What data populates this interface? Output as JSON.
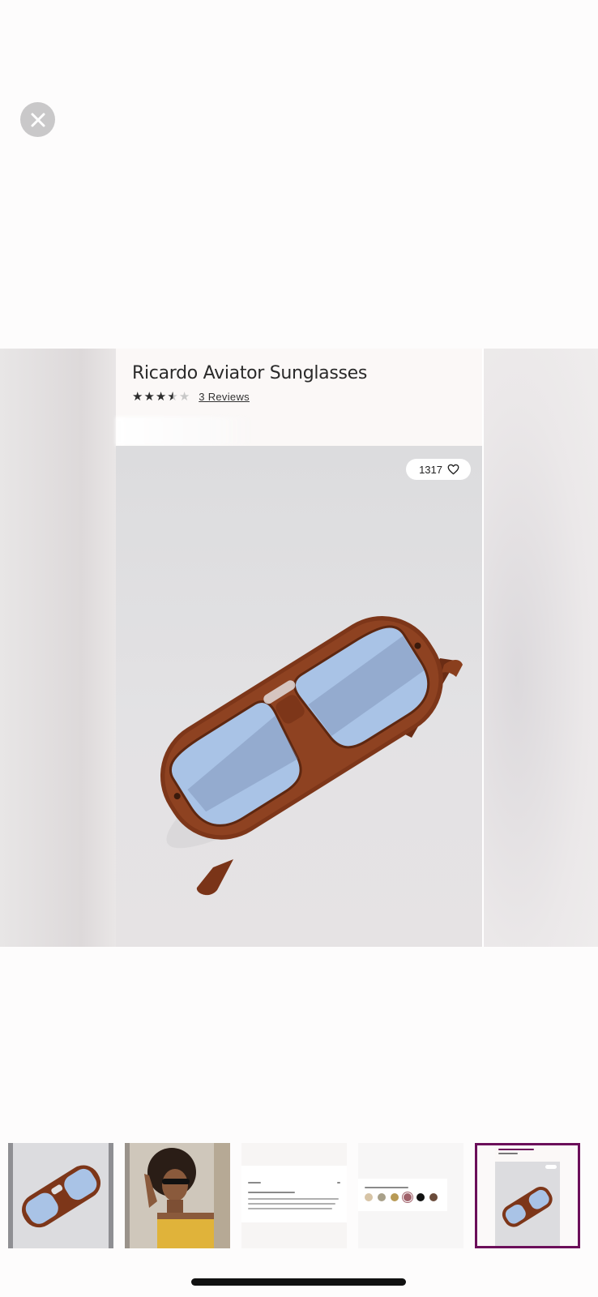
{
  "product": {
    "title": "Ricardo Aviator Sunglasses",
    "rating_stars": 3.5,
    "rating_max": 5,
    "reviews_label": "3 Reviews",
    "like_count": "1317"
  },
  "icons": {
    "close": "close-icon",
    "heart": "heart-icon",
    "star": "star-icon"
  },
  "thumbnails": [
    {
      "kind": "product-photo",
      "selected": false
    },
    {
      "kind": "model-photo",
      "selected": false
    },
    {
      "kind": "details-screenshot",
      "selected": false
    },
    {
      "kind": "color-swatches-screenshot",
      "selected": false
    },
    {
      "kind": "product-page-screenshot",
      "selected": true
    }
  ],
  "colors": {
    "selected_border": "#6b0f5a",
    "frame": "#7a3418",
    "lens": "#a9c3e6"
  },
  "swatches": [
    "#d7c4a6",
    "#a8a089",
    "#b89a55",
    "#a0616a",
    "#111111",
    "#6a4b3a"
  ]
}
